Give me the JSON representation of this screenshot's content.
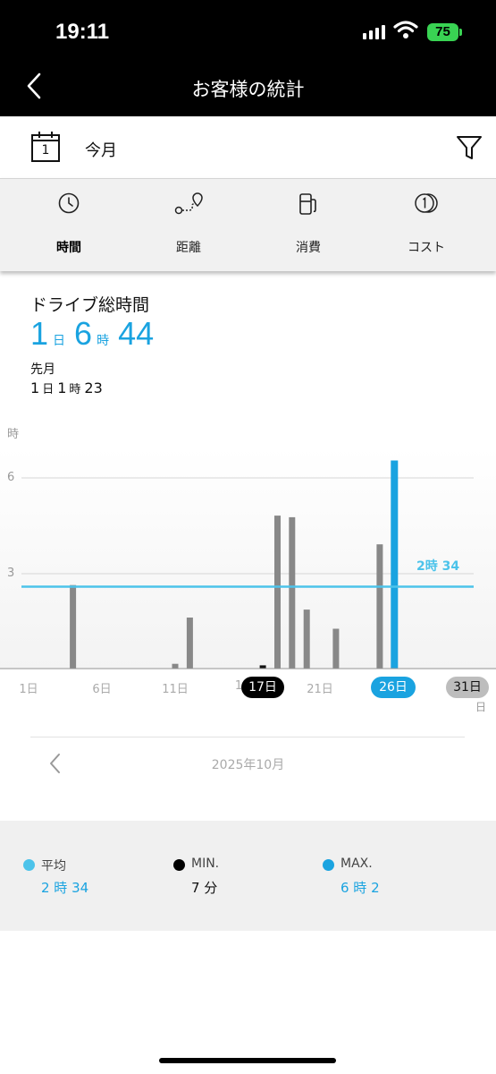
{
  "status_bar": {
    "time": "19:11",
    "battery": "75"
  },
  "header": {
    "title": "お客様の統計"
  },
  "period": {
    "calendar_day": "1",
    "label": "今月"
  },
  "tabs": [
    {
      "label": "時間",
      "icon": "clock-icon",
      "active": true
    },
    {
      "label": "距離",
      "icon": "route-icon",
      "active": false
    },
    {
      "label": "消費",
      "icon": "fuel-pump-icon",
      "active": false
    },
    {
      "label": "コスト",
      "icon": "coin-icon",
      "active": false
    }
  ],
  "summary": {
    "title": "ドライブ総時間",
    "total": {
      "days": "1",
      "days_unit": "日",
      "hours": "6",
      "hours_unit": "時",
      "minutes": "44"
    },
    "previous_label": "先月",
    "previous": {
      "days": "1",
      "days_unit": "日",
      "hours": "1",
      "hours_unit": "時",
      "minutes": "23"
    }
  },
  "chart_data": {
    "type": "bar",
    "ylabel": "時",
    "xlabel": "日",
    "ylim": [
      0,
      7.3
    ],
    "yticks": [
      3,
      6
    ],
    "xticks": [
      "1日",
      "6日",
      "11日",
      "1",
      "21日"
    ],
    "highlighted_ticks": {
      "selected": "17日",
      "max": "26日",
      "end": "31日"
    },
    "x": [
      4,
      11,
      12,
      17,
      18,
      19,
      20,
      22,
      25,
      26
    ],
    "values": [
      2.62,
      0.15,
      1.6,
      0.1,
      4.8,
      4.75,
      1.85,
      1.25,
      3.9,
      6.53
    ],
    "colors": {
      "bar": "#888888",
      "min": "#111111",
      "max": "#1aa3e0",
      "average": "#4cc3ea"
    },
    "average": {
      "value": 2.57,
      "label": "2時 34"
    },
    "grid": true
  },
  "month_nav": {
    "label": "2025年10月"
  },
  "legend": [
    {
      "name": "平均",
      "value": "2 時 34",
      "color": "#4cc3ea",
      "value_color": "#1aa3e0"
    },
    {
      "name": "MIN.",
      "value": "7 分",
      "color": "#000000",
      "value_color": "#111111"
    },
    {
      "name": "MAX.",
      "value": "6 時 2",
      "color": "#1aa3e0",
      "value_color": "#1aa3e0"
    }
  ]
}
